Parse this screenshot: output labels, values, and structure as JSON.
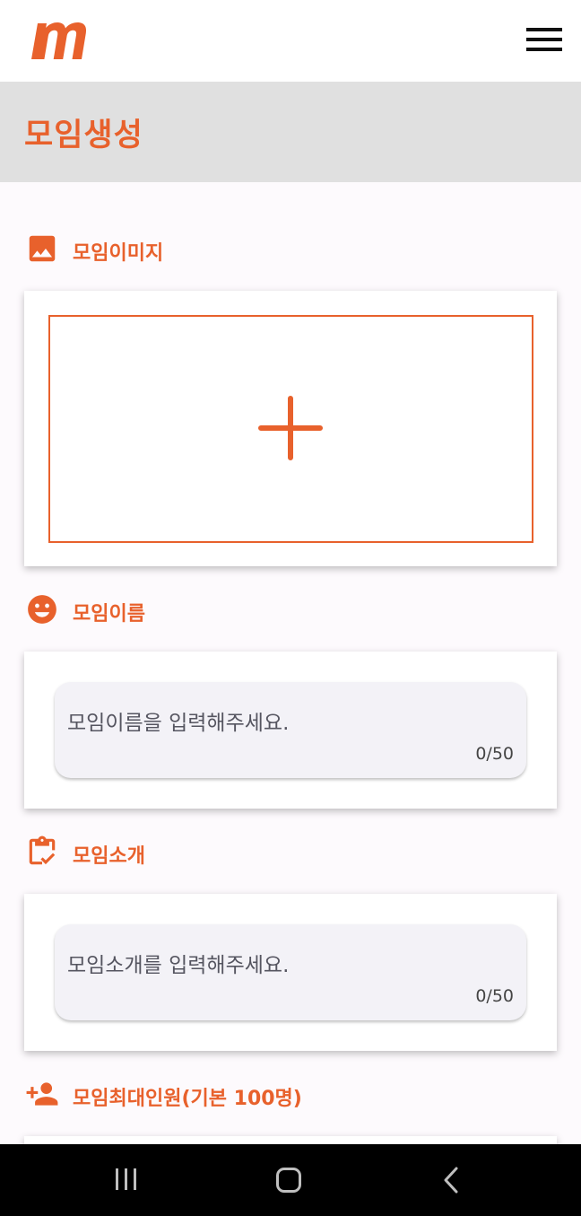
{
  "brand": {
    "accent": "#e8612c",
    "logo_icon": "m-logo-icon"
  },
  "header": {
    "menu_icon": "hamburger-icon"
  },
  "page": {
    "title": "모임생성"
  },
  "sections": {
    "image": {
      "icon": "image-icon",
      "label": "모임이미지",
      "add_icon": "plus-icon"
    },
    "name": {
      "icon": "smiley-icon",
      "label": "모임이름",
      "placeholder": "모임이름을 입력해주세요.",
      "counter": "0/50"
    },
    "intro": {
      "icon": "clipboard-check-icon",
      "label": "모임소개",
      "placeholder": "모임소개를 입력해주세요.",
      "counter": "0/50"
    },
    "max_members": {
      "icon": "person-add-icon",
      "label": "모임최대인원(기본 100명)"
    }
  },
  "navbar": {
    "recent_icon": "recent-apps-icon",
    "home_icon": "home-icon",
    "back_icon": "back-icon"
  }
}
